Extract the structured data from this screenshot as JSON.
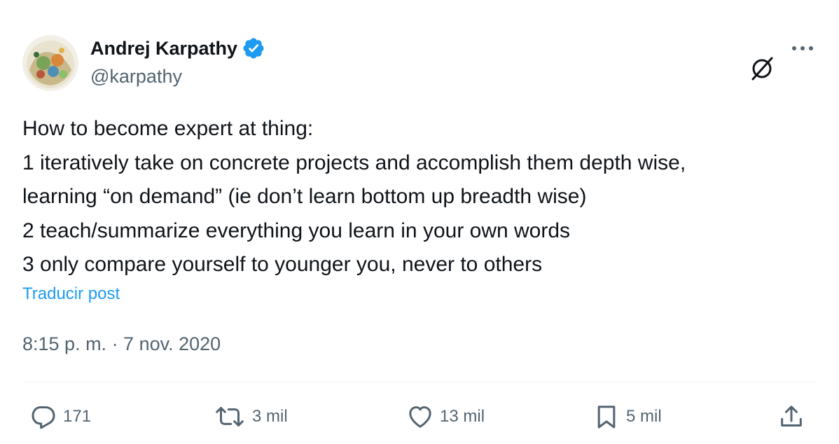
{
  "author": {
    "display_name": "Andrej Karpathy",
    "handle": "@karpathy",
    "verified": true,
    "verified_color": "#1d9bf0"
  },
  "header_icons": [
    "grok-icon",
    "more-icon"
  ],
  "tweet": {
    "lines": [
      "How to become expert at thing:",
      "1 iteratively take on concrete projects and accomplish them depth wise,",
      "learning “on demand” (ie don’t learn bottom up breadth wise)",
      "2 teach/summarize everything you learn in your own words",
      "3 only compare yourself to younger you, never to others"
    ],
    "translate_label": "Traducir post",
    "timestamp": "8:15 p. m. · 7 nov. 2020"
  },
  "actions": {
    "reply_count": "171",
    "retweet_count": "3 mil",
    "like_count": "13 mil",
    "bookmark_count": "5 mil"
  },
  "colors": {
    "text": "#0f1419",
    "secondary": "#536471",
    "link": "#1d9bf0",
    "divider": "#eff3f4"
  }
}
